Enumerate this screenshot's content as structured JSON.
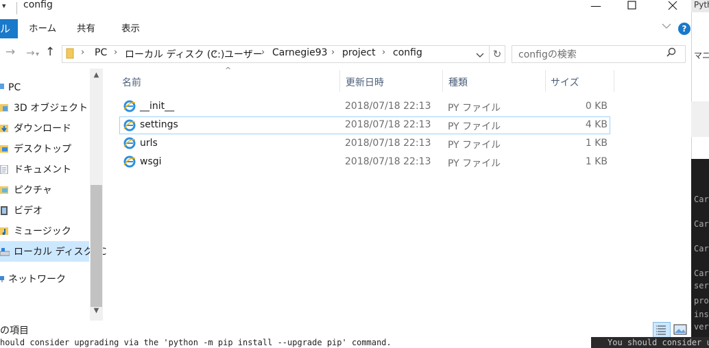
{
  "window": {
    "title": "config"
  },
  "ribbon": {
    "file_tab": "ル",
    "tabs": [
      "ホーム",
      "共有",
      "表示"
    ],
    "help": "?"
  },
  "address": {
    "crumbs": [
      "PC",
      "ローカル ディスク (C:)",
      "ユーザー",
      "Carnegie93",
      "project",
      "config"
    ],
    "search_placeholder": "configの検索"
  },
  "sidebar": {
    "items": [
      {
        "label": "PC",
        "icon": "pc-icon"
      },
      {
        "label": "3D オブジェクト",
        "icon": "3d-objects-icon"
      },
      {
        "label": "ダウンロード",
        "icon": "download-folder-icon"
      },
      {
        "label": "デスクトップ",
        "icon": "desktop-folder-icon"
      },
      {
        "label": "ドキュメント",
        "icon": "documents-folder-icon"
      },
      {
        "label": "ピクチャ",
        "icon": "pictures-folder-icon"
      },
      {
        "label": "ビデオ",
        "icon": "videos-folder-icon"
      },
      {
        "label": "ミュージック",
        "icon": "music-folder-icon"
      },
      {
        "label": "ローカル ディスク (C",
        "icon": "local-disk-icon"
      },
      {
        "label": "ネットワーク",
        "icon": "network-icon"
      }
    ]
  },
  "columns": {
    "name": "名前",
    "date": "更新日時",
    "type": "種類",
    "size": "サイズ"
  },
  "files": [
    {
      "name": "__init__",
      "date": "2018/07/18 22:13",
      "type": "PY ファイル",
      "size": "0 KB"
    },
    {
      "name": "settings",
      "date": "2018/07/18 22:13",
      "type": "PY ファイル",
      "size": "4 KB"
    },
    {
      "name": "urls",
      "date": "2018/07/18 22:13",
      "type": "PY ファイル",
      "size": "1 KB"
    },
    {
      "name": "wsgi",
      "date": "2018/07/18 22:13",
      "type": "PY ファイル",
      "size": "1 KB"
    }
  ],
  "status": {
    "text": "の項目"
  },
  "background": {
    "terminal_line": "hould consider upgrading via the 'python -m pip install --upgrade pip' command.",
    "right_terminal_line": "You should consider u",
    "right_tab": "Pyth",
    "right_mid": "マニ",
    "right_lines": [
      "Carn",
      "Carn",
      "Carn",
      "Carn",
      "sers",
      " pro",
      "inst",
      "vers"
    ]
  }
}
